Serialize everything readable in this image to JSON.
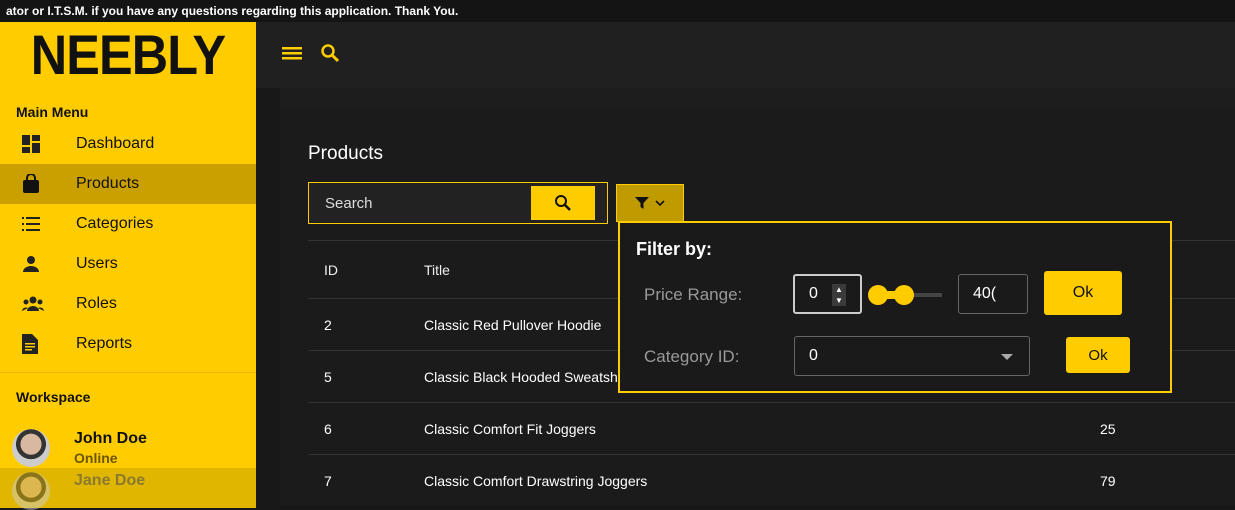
{
  "notice": "ator or I.T.S.M. if you have any questions regarding this application. Thank You.",
  "sidebar": {
    "logo": "NEEBLY",
    "main_menu": "Main Menu",
    "items": [
      {
        "label": "Dashboard"
      },
      {
        "label": "Products"
      },
      {
        "label": "Categories"
      },
      {
        "label": "Users"
      },
      {
        "label": "Roles"
      },
      {
        "label": "Reports"
      }
    ],
    "workspace": "Workspace",
    "users": [
      {
        "name": "John Doe",
        "status": "Online"
      },
      {
        "name": "Jane Doe"
      }
    ]
  },
  "page": {
    "title": "Products",
    "search_placeholder": "Search"
  },
  "table": {
    "headers": [
      "ID",
      "Title"
    ],
    "rows": [
      {
        "id": "2",
        "title": "Classic Red Pullover Hoodie",
        "price": ""
      },
      {
        "id": "5",
        "title": "Classic Black Hooded Sweatshi",
        "price": ""
      },
      {
        "id": "6",
        "title": "Classic Comfort Fit Joggers",
        "price": "25"
      },
      {
        "id": "7",
        "title": "Classic Comfort Drawstring Joggers",
        "price": "79"
      }
    ]
  },
  "filter": {
    "title": "Filter by:",
    "price_label": "Price Range:",
    "min": "0",
    "max": "40(",
    "ok": "Ok",
    "category_label": "Category ID:",
    "category_value": "0",
    "ok2": "Ok",
    "slider_min_fraction": 0,
    "slider_max_fraction": 0.4
  },
  "colors": {
    "accent": "#ffcc00"
  }
}
